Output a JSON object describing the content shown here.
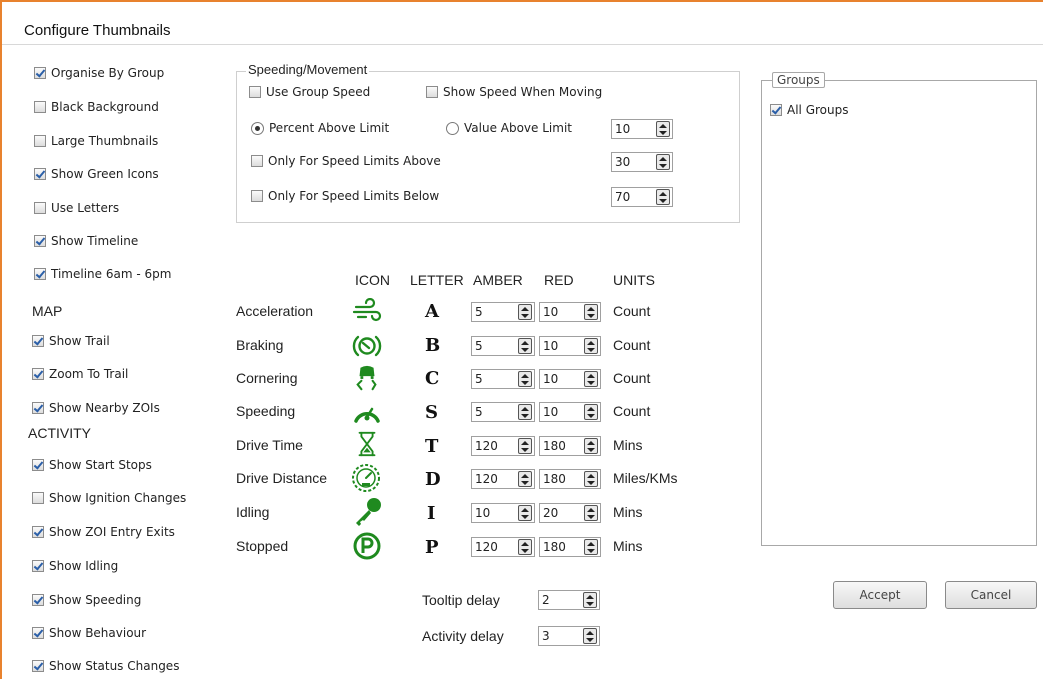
{
  "window": {
    "title": "Configure Thumbnails"
  },
  "left_options": [
    {
      "label": "Organise By Group",
      "checked": true
    },
    {
      "label": "Black Background",
      "checked": false
    },
    {
      "label": "Large Thumbnails",
      "checked": false
    },
    {
      "label": "Show Green Icons",
      "checked": true
    },
    {
      "label": "Use Letters",
      "checked": false
    },
    {
      "label": "Show Timeline",
      "checked": true
    },
    {
      "label": "Timeline 6am - 6pm",
      "checked": true
    }
  ],
  "map": {
    "title": "MAP",
    "options": [
      {
        "label": "Show Trail",
        "checked": true
      },
      {
        "label": "Zoom To Trail",
        "checked": true
      },
      {
        "label": "Show Nearby ZOIs",
        "checked": true
      }
    ]
  },
  "activity": {
    "title": "ACTIVITY",
    "options": [
      {
        "label": "Show Start Stops",
        "checked": true
      },
      {
        "label": "Show Ignition Changes",
        "checked": false
      },
      {
        "label": "Show ZOI Entry Exits",
        "checked": true
      },
      {
        "label": "Show Idling",
        "checked": true
      },
      {
        "label": "Show Speeding",
        "checked": true
      },
      {
        "label": "Show Behaviour",
        "checked": true
      },
      {
        "label": "Show Status Changes",
        "checked": true
      }
    ]
  },
  "speeding": {
    "title": "Speeding/Movement",
    "use_group_speed": {
      "label": "Use Group Speed",
      "checked": false
    },
    "show_speed_moving": {
      "label": "Show Speed When Moving",
      "checked": false
    },
    "percent_above": {
      "label": "Percent Above Limit",
      "selected": true
    },
    "value_above": {
      "label": "Value Above Limit",
      "selected": false
    },
    "limit_value": "10",
    "only_above": {
      "label": "Only For Speed Limits Above",
      "checked": false,
      "value": "30"
    },
    "only_below": {
      "label": "Only For Speed Limits Below",
      "checked": false,
      "value": "70"
    }
  },
  "thresholds": {
    "headers": {
      "icon": "ICON",
      "letter": "LETTER",
      "amber": "AMBER",
      "red": "RED",
      "units": "UNITS"
    },
    "icon_color": "#1f8a1f",
    "rows": [
      {
        "name": "Acceleration",
        "icon": "wind-icon",
        "letter": "A",
        "amber": "5",
        "red": "10",
        "units": "Count"
      },
      {
        "name": "Braking",
        "icon": "brake-icon",
        "letter": "B",
        "amber": "5",
        "red": "10",
        "units": "Count"
      },
      {
        "name": "Cornering",
        "icon": "cornering-icon",
        "letter": "C",
        "amber": "5",
        "red": "10",
        "units": "Count"
      },
      {
        "name": "Speeding",
        "icon": "speedometer-icon",
        "letter": "S",
        "amber": "5",
        "red": "10",
        "units": "Count"
      },
      {
        "name": "Drive Time",
        "icon": "hourglass-icon",
        "letter": "T",
        "amber": "120",
        "red": "180",
        "units": "Mins"
      },
      {
        "name": "Drive Distance",
        "icon": "odometer-icon",
        "letter": "D",
        "amber": "120",
        "red": "180",
        "units": "Miles/KMs"
      },
      {
        "name": "Idling",
        "icon": "key-icon",
        "letter": "I",
        "amber": "10",
        "red": "20",
        "units": "Mins"
      },
      {
        "name": "Stopped",
        "icon": "parking-icon",
        "letter": "P",
        "amber": "120",
        "red": "180",
        "units": "Mins"
      }
    ]
  },
  "delays": {
    "tooltip": {
      "label": "Tooltip delay",
      "value": "2"
    },
    "activity": {
      "label": "Activity delay",
      "value": "3"
    }
  },
  "groups": {
    "title": "Groups",
    "items": [
      {
        "label": "All Groups",
        "checked": true
      }
    ]
  },
  "buttons": {
    "accept": "Accept",
    "cancel": "Cancel"
  }
}
